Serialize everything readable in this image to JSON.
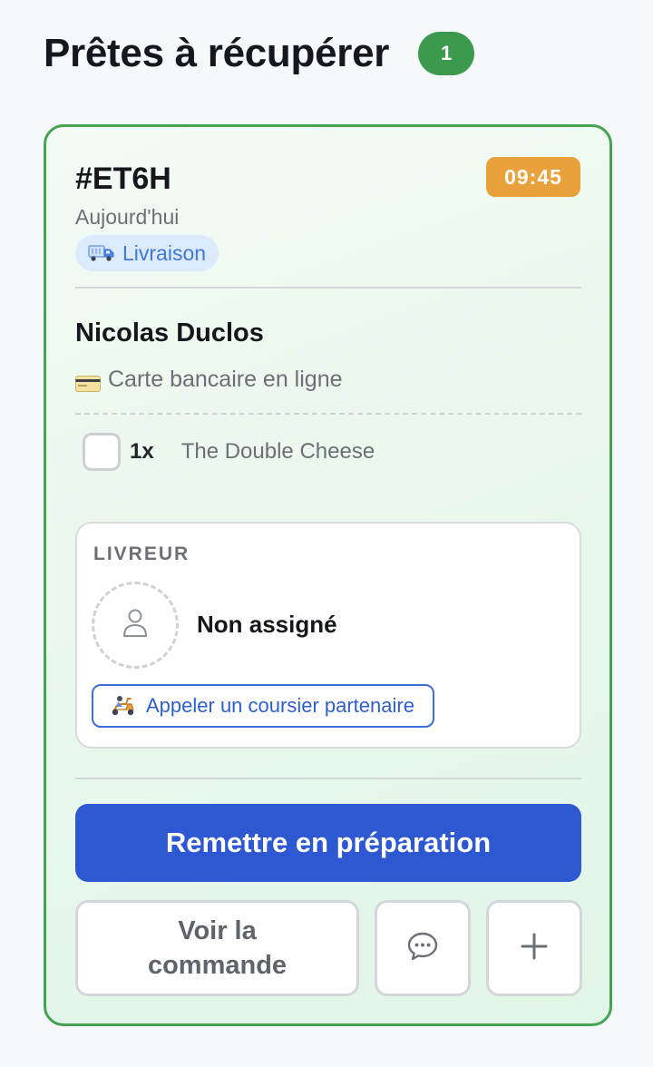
{
  "section": {
    "title": "Prêtes à récupérer",
    "count": "1"
  },
  "order": {
    "id": "#ET6H",
    "time": "09:45",
    "date": "Aujourd'hui",
    "mode_label": "Livraison",
    "customer_name": "Nicolas Duclos",
    "payment_label": "Carte bancaire en ligne",
    "items": [
      {
        "qty": "1x",
        "name": "The Double Cheese",
        "checked": false
      }
    ]
  },
  "driver": {
    "heading": "LIVREUR",
    "status": "Non assigné",
    "call_partner_label": "Appeler un coursier partenaire"
  },
  "actions": {
    "primary_label": "Remettre en préparation",
    "view_order_label": "Voir la commande"
  },
  "icons": {
    "delivery": "truck-icon",
    "payment": "credit-card-icon",
    "avatar": "user-icon",
    "courier": "scooter-icon",
    "chat": "chat-bubble-icon",
    "more": "plus-icon"
  },
  "colors": {
    "card_border": "#45a352",
    "count_badge": "#3c9a4f",
    "time_badge": "#e9a23b",
    "primary_button": "#2d58d2",
    "delivery_chip_bg": "#dceafd",
    "delivery_chip_text": "#3f78d8"
  }
}
